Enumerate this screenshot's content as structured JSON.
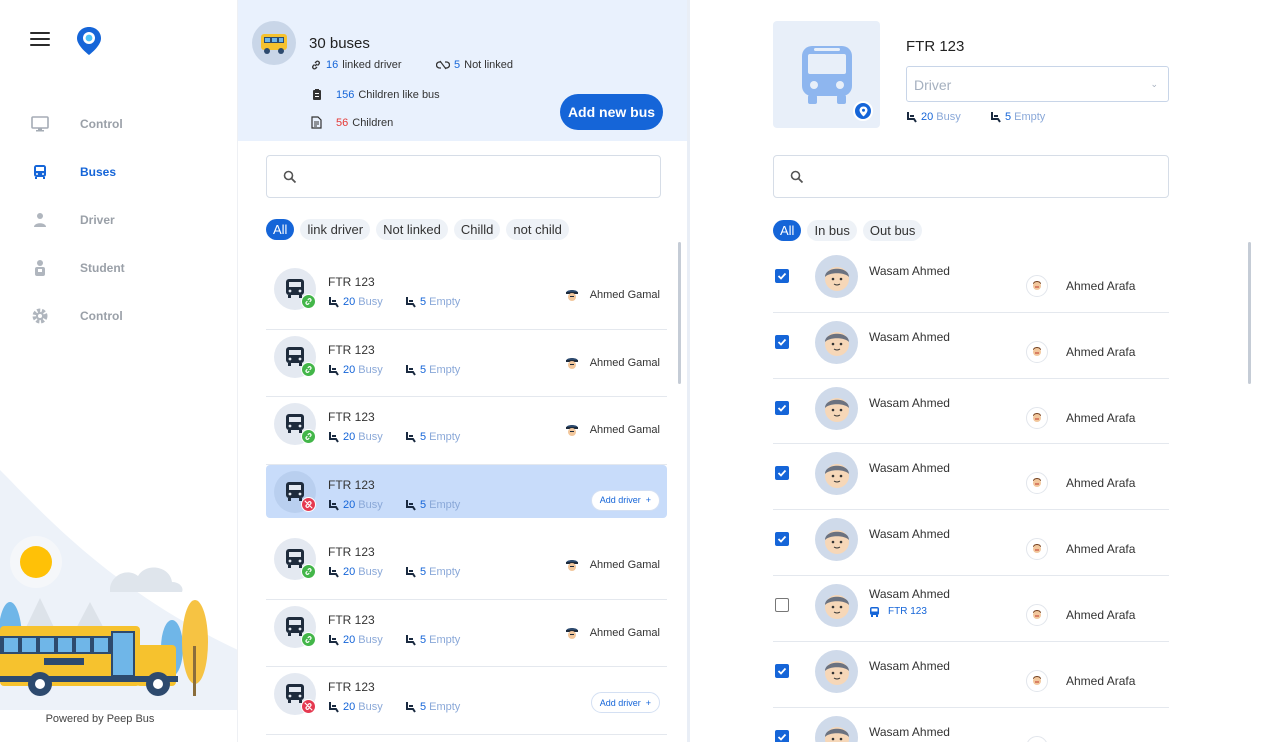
{
  "brand": {
    "powered_by": "Powered by Peep Bus",
    "accent": "#1565d8"
  },
  "sidebar": {
    "items": [
      {
        "label": "Control",
        "icon": "monitor-icon",
        "active": false
      },
      {
        "label": "Buses",
        "icon": "bus-icon",
        "active": true
      },
      {
        "label": "Driver",
        "icon": "driver-icon",
        "active": false
      },
      {
        "label": "Student",
        "icon": "student-icon",
        "active": false
      },
      {
        "label": "Control",
        "icon": "gear-icon",
        "active": false
      }
    ]
  },
  "buses_header": {
    "title": "30 buses",
    "linked_count": "16",
    "linked_label": "linked driver",
    "not_linked_count": "5",
    "not_linked_label": "Not linked",
    "children_like_count": "156",
    "children_like_label": "Children like bus",
    "children_count": "56",
    "children_label": "Children",
    "add_button": "Add new bus"
  },
  "bus_search": {
    "placeholder": ""
  },
  "bus_filters": [
    "All",
    "link driver",
    "Not linked",
    "Chilld",
    "not child"
  ],
  "bus_list": [
    {
      "name": "FTR 123",
      "busy": "20",
      "busy_label": "Busy",
      "empty": "5",
      "empty_label": "Empty",
      "linked": true,
      "driver": "Ahmed Gamal"
    },
    {
      "name": "FTR 123",
      "busy": "20",
      "busy_label": "Busy",
      "empty": "5",
      "empty_label": "Empty",
      "linked": true,
      "driver": "Ahmed Gamal"
    },
    {
      "name": "FTR 123",
      "busy": "20",
      "busy_label": "Busy",
      "empty": "5",
      "empty_label": "Empty",
      "linked": true,
      "driver": "Ahmed Gamal"
    },
    {
      "name": "FTR 123",
      "busy": "20",
      "busy_label": "Busy",
      "empty": "5",
      "empty_label": "Empty",
      "linked": false,
      "selected": true,
      "add_driver": "Add driver"
    },
    {
      "name": "FTR 123",
      "busy": "20",
      "busy_label": "Busy",
      "empty": "5",
      "empty_label": "Empty",
      "linked": true,
      "driver": "Ahmed Gamal"
    },
    {
      "name": "FTR 123",
      "busy": "20",
      "busy_label": "Busy",
      "empty": "5",
      "empty_label": "Empty",
      "linked": true,
      "driver": "Ahmed Gamal"
    },
    {
      "name": "FTR 123",
      "busy": "20",
      "busy_label": "Busy",
      "empty": "5",
      "empty_label": "Empty",
      "linked": false,
      "add_driver": "Add driver"
    }
  ],
  "detail": {
    "title": "FTR 123",
    "driver_placeholder": "Driver",
    "busy": "20",
    "busy_label": "Busy",
    "empty": "5",
    "empty_label": "Empty"
  },
  "student_search": {
    "placeholder": ""
  },
  "student_filters": [
    "All",
    "In bus",
    "Out bus"
  ],
  "students": [
    {
      "name": "Wasam Ahmed",
      "parent": "Ahmed Arafa",
      "checked": true
    },
    {
      "name": "Wasam Ahmed",
      "parent": "Ahmed Arafa",
      "checked": true
    },
    {
      "name": "Wasam Ahmed",
      "parent": "Ahmed Arafa",
      "checked": true
    },
    {
      "name": "Wasam Ahmed",
      "parent": "Ahmed Arafa",
      "checked": true
    },
    {
      "name": "Wasam Ahmed",
      "parent": "Ahmed Arafa",
      "checked": true
    },
    {
      "name": "Wasam Ahmed",
      "parent": "Ahmed Arafa",
      "checked": false,
      "bus": "FTR 123"
    },
    {
      "name": "Wasam Ahmed",
      "parent": "Ahmed Arafa",
      "checked": true
    },
    {
      "name": "Wasam Ahmed",
      "parent": "Ahmed Arafa",
      "checked": true
    }
  ]
}
